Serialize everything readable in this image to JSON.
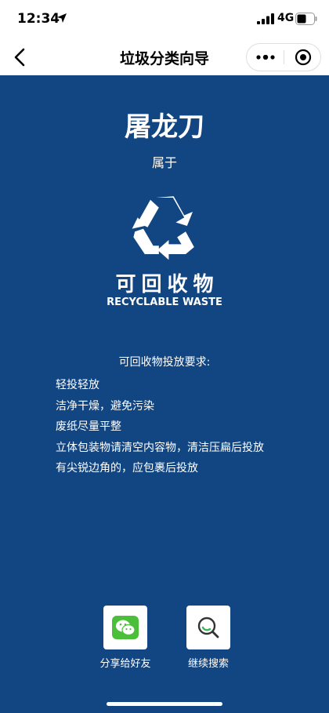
{
  "status_bar": {
    "time": "12:34",
    "network": "4G"
  },
  "nav": {
    "title": "垃圾分类向导"
  },
  "result": {
    "item_name": "屠龙刀",
    "belongs_label": "属于",
    "category_cn": "可回收物",
    "category_en": "RECYCLABLE WASTE"
  },
  "requirements": {
    "title": "可回收物投放要求:",
    "items": [
      "轻投轻放",
      "洁净干燥，避免污染",
      "废纸尽量平整",
      "立体包装物请清空内容物，清洁压扁后投放",
      "有尖锐边角的，应包裹后投放"
    ]
  },
  "actions": {
    "share_label": "分享给好友",
    "continue_label": "继续搜索"
  },
  "colors": {
    "background": "#124682",
    "wechat_green": "#4cbf3a",
    "search_accent": "#3db35a"
  }
}
